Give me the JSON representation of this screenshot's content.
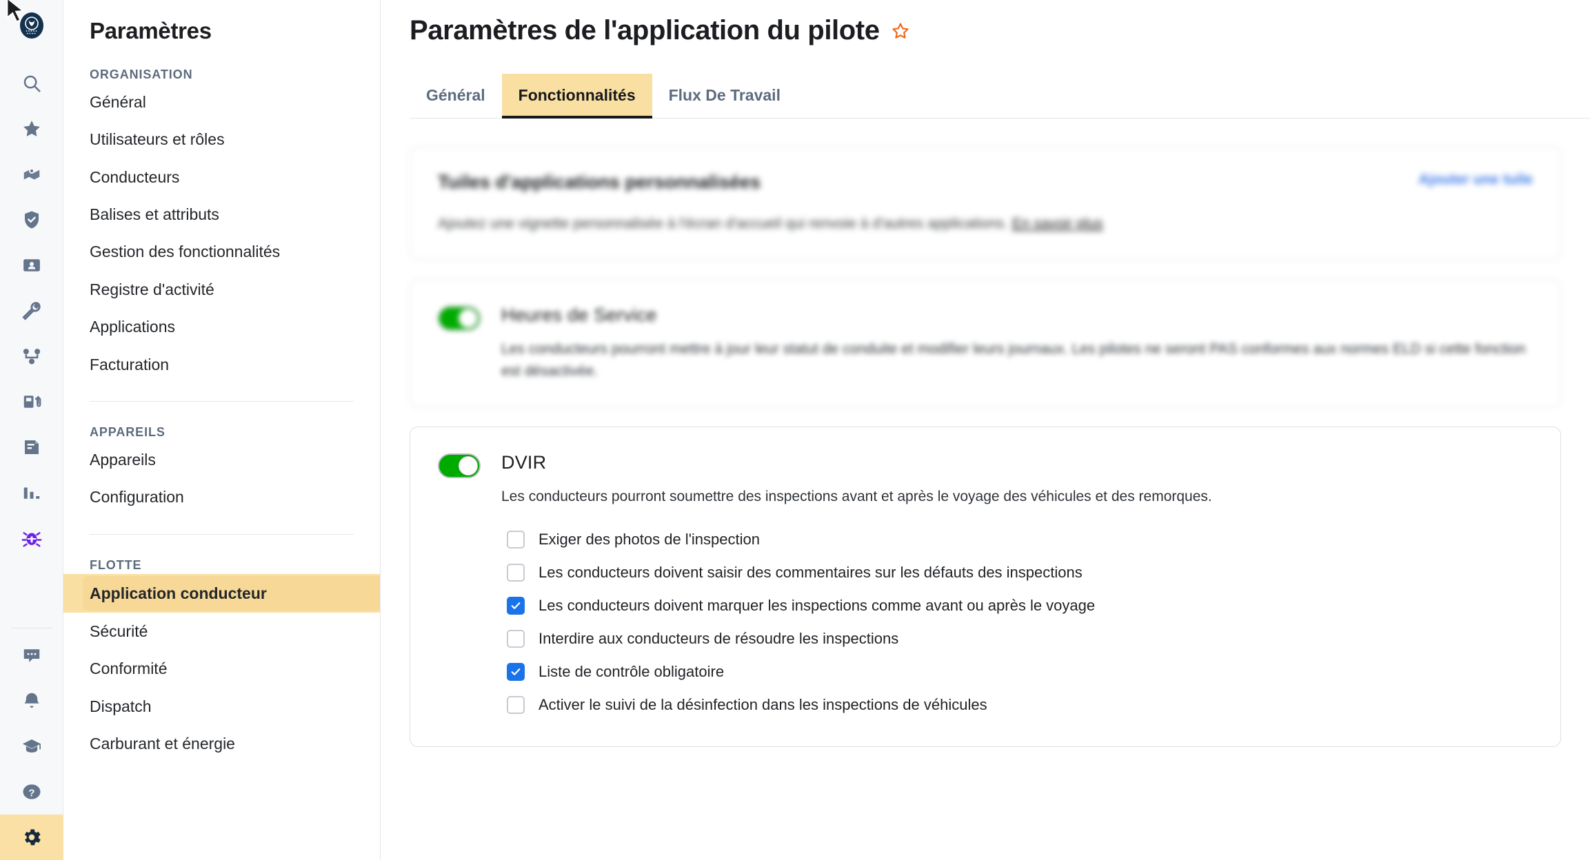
{
  "rail": {
    "logo_icon": "samsara-owl-logo",
    "top_items": [
      {
        "icon": "search-icon",
        "name": "search"
      },
      {
        "icon": "star-icon",
        "name": "favorites"
      },
      {
        "icon": "map-pin-icon",
        "name": "map"
      },
      {
        "icon": "shield-check-icon",
        "name": "safety"
      },
      {
        "icon": "id-card-icon",
        "name": "drivers"
      },
      {
        "icon": "wrench-icon",
        "name": "maintenance"
      },
      {
        "icon": "route-icon",
        "name": "routing"
      },
      {
        "icon": "fuel-pump-icon",
        "name": "fuel"
      },
      {
        "icon": "document-icon",
        "name": "documents"
      },
      {
        "icon": "bar-chart-icon",
        "name": "reports"
      },
      {
        "icon": "bug-icon",
        "name": "debug"
      }
    ],
    "bottom_items": [
      {
        "icon": "chat-bubble-icon",
        "name": "messages"
      },
      {
        "icon": "bell-icon",
        "name": "notifications"
      },
      {
        "icon": "graduation-cap-icon",
        "name": "training"
      },
      {
        "icon": "question-mark-icon",
        "name": "help"
      },
      {
        "icon": "gear-icon",
        "name": "settings",
        "active": true
      }
    ]
  },
  "sidebar": {
    "title": "Paramètres",
    "groups": [
      {
        "label": "ORGANISATION",
        "items": [
          {
            "label": "Général"
          },
          {
            "label": "Utilisateurs et rôles"
          },
          {
            "label": "Conducteurs"
          },
          {
            "label": "Balises et attributs"
          },
          {
            "label": "Gestion des fonctionnalités"
          },
          {
            "label": "Registre d'activité"
          },
          {
            "label": "Applications"
          },
          {
            "label": "Facturation"
          }
        ]
      },
      {
        "label": "APPAREILS",
        "items": [
          {
            "label": "Appareils"
          },
          {
            "label": "Configuration"
          }
        ]
      },
      {
        "label": "FLOTTE",
        "items": [
          {
            "label": "Application conducteur",
            "selected": true
          },
          {
            "label": "Sécurité"
          },
          {
            "label": "Conformité"
          },
          {
            "label": "Dispatch"
          },
          {
            "label": "Carburant et énergie"
          }
        ]
      }
    ]
  },
  "main": {
    "page_title": "Paramètres de l'application du pilote",
    "favorite_icon": "star-outline-icon",
    "favorite_color": "#f2671f",
    "tabs": [
      {
        "label": "Général",
        "active": false
      },
      {
        "label": "Fonctionnalités",
        "active": true
      },
      {
        "label": "Flux De Travail",
        "active": false
      }
    ],
    "cards": [
      {
        "type": "link-card",
        "blurred": true,
        "title": "Tuiles d'applications personnalisées",
        "action_label": "Ajouter une tuile",
        "description": "Ajoutez une vignette personnalisée à l'écran d'accueil qui renvoie à d'autres applications.",
        "description_link": "En savoir plus"
      },
      {
        "type": "toggle-card",
        "blurred": true,
        "enabled": true,
        "title": "Heures de Service",
        "description": "Les conducteurs pourront mettre à jour leur statut de conduite et modifier leurs journaux. Les pilotes ne seront PAS conformes aux normes ELD si cette fonction est désactivée."
      },
      {
        "type": "toggle-card",
        "blurred": false,
        "enabled": true,
        "title": "DVIR",
        "description": "Les conducteurs pourront soumettre des inspections avant et après le voyage des véhicules et des remorques.",
        "checkboxes": [
          {
            "label": "Exiger des photos de l'inspection",
            "checked": false
          },
          {
            "label": "Les conducteurs doivent saisir des commentaires sur les défauts des inspections",
            "checked": false
          },
          {
            "label": "Les conducteurs doivent marquer les inspections comme avant ou après le voyage",
            "checked": true
          },
          {
            "label": "Interdire aux conducteurs de résoudre les inspections",
            "checked": false
          },
          {
            "label": "Liste de contrôle obligatoire",
            "checked": true
          },
          {
            "label": "Activer le suivi de la désinfection dans les inspections de véhicules",
            "checked": false
          }
        ]
      }
    ]
  },
  "colors": {
    "accent_highlight": "#fadfa2",
    "toggle_on": "#00ab00",
    "checkbox_checked": "#1a73e8",
    "favorite_star": "#f2671f",
    "link_blue": "#3d7ae8"
  }
}
